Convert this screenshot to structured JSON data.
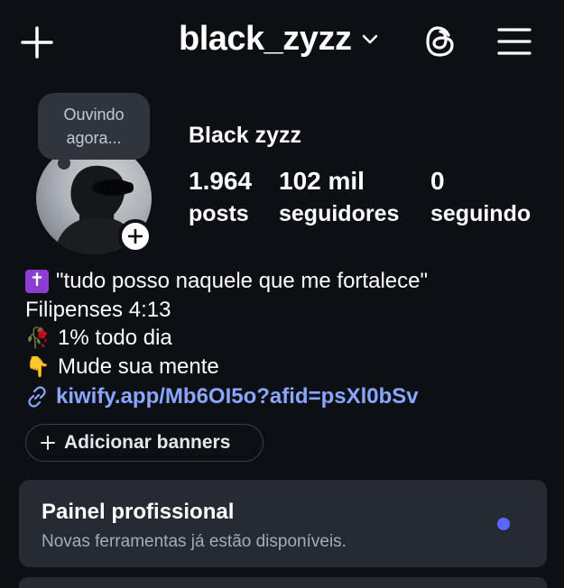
{
  "header": {
    "username": "black_zyzz"
  },
  "note": {
    "line1": "Ouvindo",
    "line2": "agora..."
  },
  "profile": {
    "display_name": "Black zyzz",
    "stats": {
      "posts": {
        "value": "1.964",
        "label": "posts"
      },
      "followers": {
        "value": "102 mil",
        "label": "seguidores"
      },
      "following": {
        "value": "0",
        "label": "seguindo"
      }
    }
  },
  "bio": {
    "line1": "\"tudo posso naquele que me fortalece\"",
    "line2": "Filipenses 4:13",
    "line3_emoji": "🥀",
    "line3": "1% todo dia",
    "line4_emoji": "👇",
    "line4": "Mude sua mente",
    "link": "kiwify.app/Mb6OI5o?afid=psXl0bSv"
  },
  "banners_button": {
    "label": "Adicionar banners"
  },
  "pro_panel": {
    "title": "Painel profissional",
    "subtitle": "Novas ferramentas já estão disponíveis."
  },
  "colors": {
    "background": "#0c0f14",
    "link": "#8aa6ff",
    "panel": "#262b33",
    "accent_dot": "#5a66ff",
    "cross_badge": "#8b3fd0"
  },
  "icons": [
    "plus-icon",
    "chevron-down-icon",
    "threads-icon",
    "hamburger-menu-icon",
    "link-icon",
    "add-story-plus-icon"
  ]
}
